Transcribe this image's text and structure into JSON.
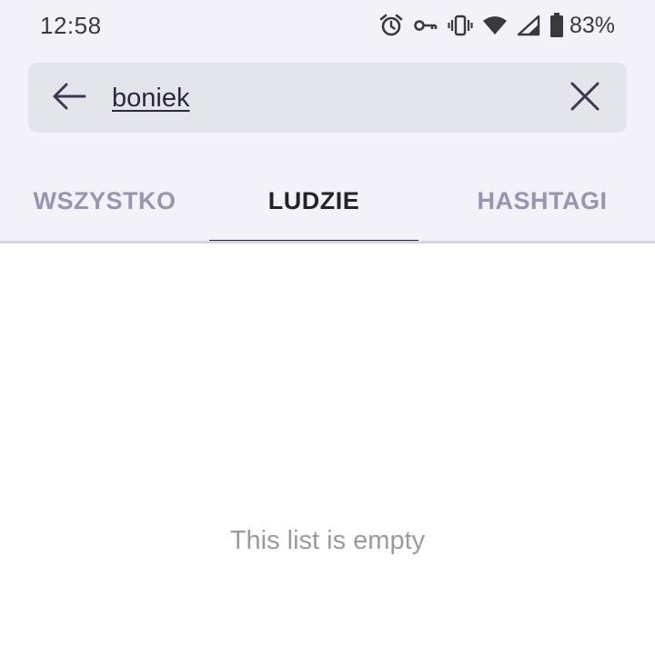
{
  "status_bar": {
    "time": "12:58",
    "battery_percent": "83%",
    "icons": [
      "alarm-icon",
      "vpn-key-icon",
      "vibrate-icon",
      "wifi-icon",
      "cell-signal-icon",
      "battery-icon"
    ]
  },
  "search": {
    "query": "boniek",
    "back_icon": "arrow-left-icon",
    "clear_icon": "close-icon"
  },
  "tabs": [
    {
      "label": "WSZYSTKO",
      "active": false
    },
    {
      "label": "LUDZIE",
      "active": true
    },
    {
      "label": "HASHTAGI",
      "active": false
    }
  ],
  "results": {
    "empty_message": "This list is empty"
  },
  "colors": {
    "header_bg": "#f2f2f8",
    "search_bg": "#e4e5eb",
    "tab_inactive": "#9a94b2",
    "tab_active": "#24222e",
    "indicator": "#28263a",
    "empty_text": "#9b9b9b"
  }
}
